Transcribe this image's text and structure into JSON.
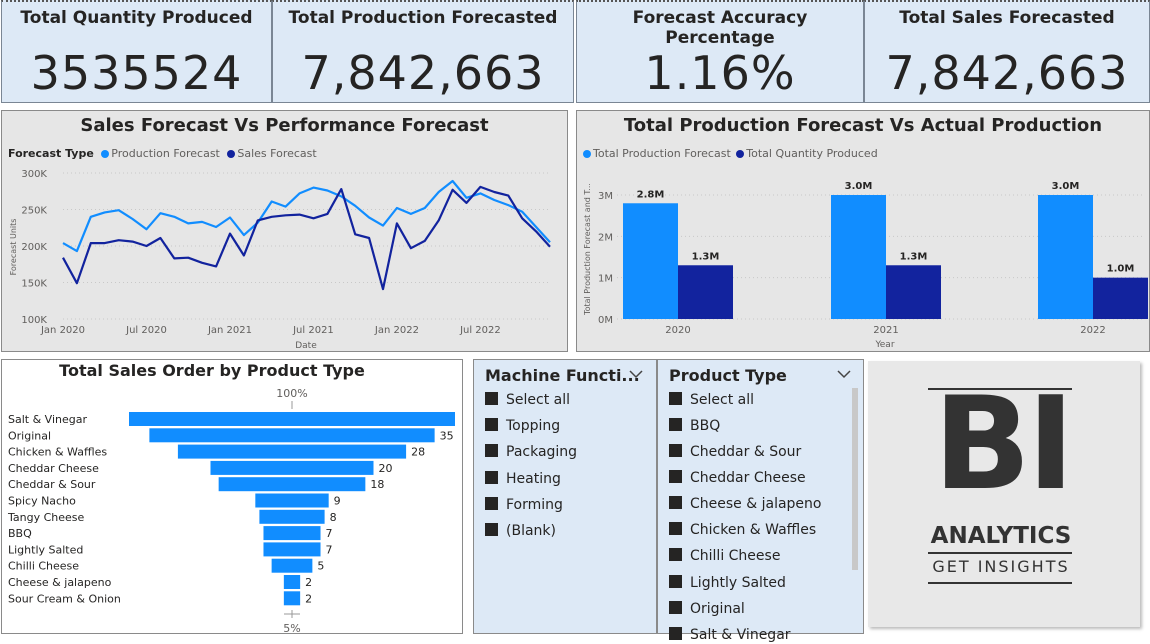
{
  "kpis": [
    {
      "title": "Total Quantity Produced",
      "value": "3535524"
    },
    {
      "title": "Total Production Forecasted",
      "value": "7,842,663"
    },
    {
      "title": "Forecast Accuracy Percentage",
      "value": "1.16%"
    },
    {
      "title": "Total Sales Forecasted",
      "value": "7,842,663"
    }
  ],
  "line_chart": {
    "title": "Sales Forecast Vs Performance Forecast",
    "legend_title": "Forecast Type",
    "legend": [
      "Production Forecast",
      "Sales Forecast"
    ],
    "ylabel": "Forecast Units",
    "xlabel": "Date",
    "yticks": [
      "300K",
      "250K",
      "200K",
      "150K",
      "100K"
    ],
    "xticks": [
      "Jan 2020",
      "Jul 2020",
      "Jan 2021",
      "Jul 2021",
      "Jan 2022",
      "Jul 2022"
    ]
  },
  "bar_chart": {
    "title": "Total Production Forecast Vs Actual Production",
    "legend": [
      "Total Production Forecast",
      "Total Quantity Produced"
    ],
    "ylabel": "Total Production Forecast and T...",
    "xlabel": "Year",
    "yticks": [
      "3M",
      "2M",
      "1M",
      "0M"
    ],
    "years": [
      "2020",
      "2021",
      "2022"
    ],
    "forecast_labels": [
      "2.8M",
      "3.0M",
      "3.0M"
    ],
    "produced_labels": [
      "1.3M",
      "1.3M",
      "1.0M"
    ]
  },
  "funnel": {
    "title": "Total Sales Order by Product Type",
    "top_pct": "100%",
    "bottom_pct": "5%",
    "categories": [
      "Salt & Vinegar",
      "Original",
      "Chicken & Waffles",
      "Cheddar Cheese",
      "Cheddar & Sour",
      "Spicy Nacho",
      "Tangy Cheese",
      "BBQ",
      "Lightly Salted",
      "Chilli Cheese",
      "Cheese & jalapeno",
      "Sour Cream & Onion"
    ],
    "value_labels": [
      "",
      "35",
      "28",
      "20",
      "18",
      "9",
      "8",
      "7",
      "7",
      "5",
      "2",
      "2"
    ]
  },
  "slicer_machine": {
    "title": "Machine Functi...",
    "items": [
      "Select all",
      "Topping",
      "Packaging",
      "Heating",
      "Forming",
      "(Blank)"
    ]
  },
  "slicer_product": {
    "title": "Product Type",
    "items": [
      "Select all",
      "BBQ",
      "Cheddar & Sour",
      "Cheddar Cheese",
      "Cheese & jalapeno",
      "Chicken & Waffles",
      "Chilli Cheese",
      "Lightly Salted",
      "Original",
      "Salt & Vinegar"
    ]
  },
  "logo": {
    "big": "BI",
    "line1": "ANALYTICS",
    "line2": "GET INSIGHTS"
  },
  "colors": {
    "light_blue": "#118dff",
    "dark_blue": "#12239e",
    "panel": "#e6e6e6",
    "kpi_bg": "#dde9f6"
  },
  "chart_data": [
    {
      "type": "line",
      "title": "Sales Forecast Vs Performance Forecast",
      "xlabel": "Date",
      "ylabel": "Forecast Units",
      "ylim": [
        100000,
        300000
      ],
      "x_start": "Jan 2020",
      "x_end": "Dec 2022",
      "x": [
        "2020-01",
        "2020-02",
        "2020-03",
        "2020-04",
        "2020-05",
        "2020-06",
        "2020-07",
        "2020-08",
        "2020-09",
        "2020-10",
        "2020-11",
        "2020-12",
        "2021-01",
        "2021-02",
        "2021-03",
        "2021-04",
        "2021-05",
        "2021-06",
        "2021-07",
        "2021-08",
        "2021-09",
        "2021-10",
        "2021-11",
        "2021-12",
        "2022-01",
        "2022-02",
        "2022-03",
        "2022-04",
        "2022-05",
        "2022-06",
        "2022-07",
        "2022-08",
        "2022-09",
        "2022-10",
        "2022-11",
        "2022-12"
      ],
      "series": [
        {
          "name": "Production Forecast",
          "values": [
            204000,
            193000,
            240000,
            246000,
            249000,
            237000,
            223000,
            245000,
            240000,
            231000,
            233000,
            226000,
            239000,
            215000,
            232000,
            261000,
            254000,
            272000,
            280000,
            276000,
            268000,
            255000,
            239000,
            228000,
            252000,
            244000,
            252000,
            274000,
            289000,
            266000,
            272000,
            263000,
            256000,
            247000,
            226000,
            205000
          ]
        },
        {
          "name": "Sales Forecast",
          "values": [
            184000,
            149000,
            204000,
            204000,
            208000,
            206000,
            200000,
            211000,
            183000,
            184000,
            177000,
            172000,
            217000,
            187000,
            235000,
            240000,
            242000,
            243000,
            238000,
            244000,
            278000,
            216000,
            211000,
            141000,
            231000,
            197000,
            207000,
            235000,
            277000,
            259000,
            281000,
            274000,
            269000,
            238000,
            220000,
            199000
          ]
        }
      ]
    },
    {
      "type": "bar",
      "title": "Total Production Forecast Vs Actual Production",
      "xlabel": "Year",
      "ylabel": "Total Production Forecast and T...",
      "categories": [
        "2020",
        "2021",
        "2022"
      ],
      "ylim": [
        0,
        3000000
      ],
      "series": [
        {
          "name": "Total Production Forecast",
          "values": [
            2800000,
            3000000,
            3000000
          ]
        },
        {
          "name": "Total Quantity Produced",
          "values": [
            1300000,
            1300000,
            1000000
          ]
        }
      ]
    },
    {
      "type": "bar",
      "orientation": "funnel",
      "title": "Total Sales Order by Product Type",
      "categories": [
        "Salt & Vinegar",
        "Original",
        "Chicken & Waffles",
        "Cheddar Cheese",
        "Cheddar & Sour",
        "Spicy Nacho",
        "Tangy Cheese",
        "BBQ",
        "Lightly Salted",
        "Chilli Cheese",
        "Cheese & jalapeno",
        "Sour Cream & Onion"
      ],
      "values": [
        40,
        35,
        28,
        20,
        18,
        9,
        8,
        7,
        7,
        5,
        2,
        2
      ]
    }
  ]
}
